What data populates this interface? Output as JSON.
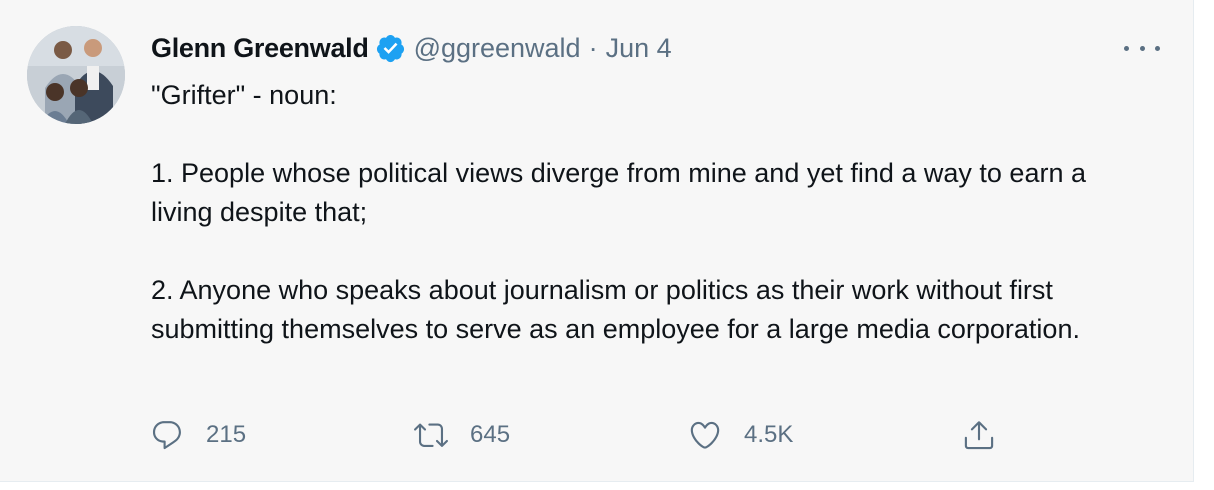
{
  "tweet": {
    "author": {
      "display_name": "Glenn Greenwald",
      "handle": "@ggreenwald",
      "verified": true
    },
    "separator": "·",
    "date": "Jun 4",
    "text": {
      "line1": "\"Grifter\" - noun:",
      "para1": "1. People whose political views diverge from mine and yet find a way to earn a living despite that;",
      "para2": "2. Anyone who speaks about journalism or politics as their work without first submitting themselves to serve as an employee for a large media corporation."
    },
    "stats": {
      "replies": "215",
      "retweets": "645",
      "likes": "4.5K"
    }
  },
  "icons": {
    "avatar": "profile-photo",
    "verified": "verified-badge-icon",
    "more": "more-icon",
    "reply": "reply-icon",
    "retweet": "retweet-icon",
    "like": "heart-icon",
    "share": "share-icon"
  },
  "colors": {
    "verified_blue": "#1da1f2",
    "secondary_text": "#5b7083",
    "background": "#f7f7f7"
  }
}
